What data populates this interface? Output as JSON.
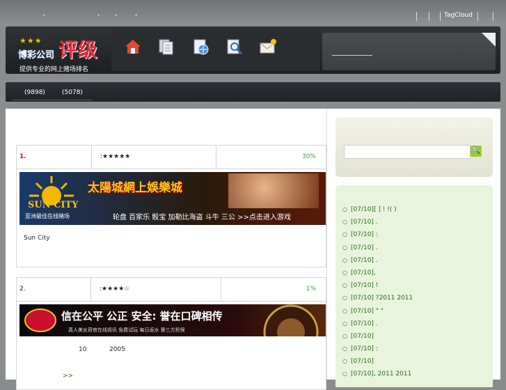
{
  "topbar": {
    "commas": [
      ",",
      ",",
      ",",
      ","
    ],
    "tagcloud": "TagCloud"
  },
  "logo": {
    "stars": "★★★",
    "brand": "博彩公司",
    "title": "评级",
    "tagline": "提供专业的网上赌场排名"
  },
  "nav_icons": [
    "home-icon",
    "documents-icon",
    "globe-icon",
    "search-doc-icon",
    "mail-icon"
  ],
  "subnav": {
    "item1": "(9898)",
    "item2": "(5078)"
  },
  "listing": [
    {
      "rank": "1.",
      "stars": ":★★★★★",
      "percent": "30%",
      "banner_text": "太陽城網上娛樂城",
      "banner_sub": "亚洲最佳在线赌场",
      "banner_games": "轮盘 百家乐 骰宝 加勒比海盗 斗牛 三公 >>点击进入游戏",
      "logo_text": "SUN CITY",
      "desc": "Sun City"
    },
    {
      "rank": "2.",
      "stars": ":★★★★☆",
      "percent": "1%",
      "banner_text": "信在公平 公正 安全: 誉在口碑相传",
      "banner_sub": "真人美女荷官在线视讯 免费试玩 每日返水 第三方担保",
      "desc_num1": "10",
      "desc_num2": "2005",
      "more": ">>"
    }
  ],
  "news": [
    "[07/10][ ]      !           !(  )",
    "[07/10]                  .",
    "[07/10]     :",
    "[07/10]            .",
    "[07/10]      .",
    "[07/10],",
    "[07/10]            !",
    "[07/10]    ?2011       2011",
    "[07/10]    \" \"",
    "[07/10]    .",
    "[07/10]",
    "[07/10]    :",
    "[07/10]",
    "[07/10],      2011       2011"
  ],
  "search": {
    "button": "🔍"
  }
}
